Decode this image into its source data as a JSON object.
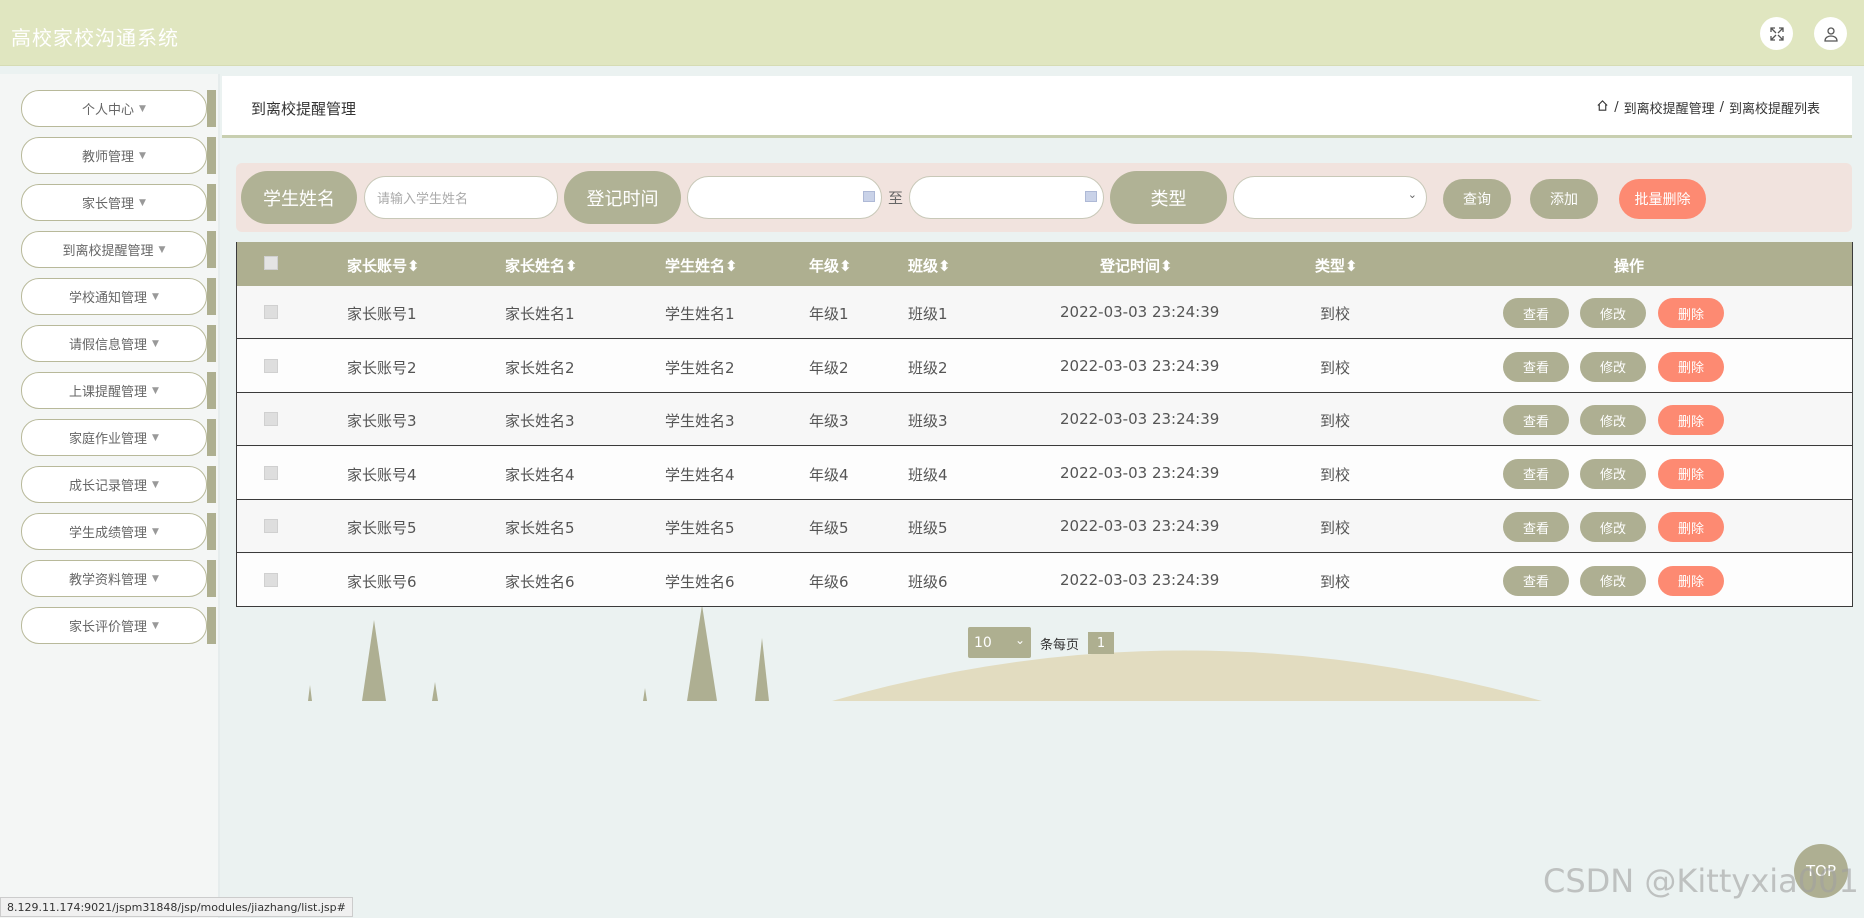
{
  "header": {
    "app_title": "高校家校沟通系统",
    "icons": [
      "fullscreen-icon",
      "user-icon"
    ]
  },
  "sidebar": {
    "items": [
      {
        "label": "个人中心"
      },
      {
        "label": "教师管理"
      },
      {
        "label": "家长管理"
      },
      {
        "label": "到离校提醒管理"
      },
      {
        "label": "学校通知管理"
      },
      {
        "label": "请假信息管理"
      },
      {
        "label": "上课提醒管理"
      },
      {
        "label": "家庭作业管理"
      },
      {
        "label": "成长记录管理"
      },
      {
        "label": "学生成绩管理"
      },
      {
        "label": "教学资料管理"
      },
      {
        "label": "家长评价管理"
      }
    ]
  },
  "page": {
    "title": "到离校提醒管理",
    "breadcrumb": [
      "到离校提醒管理",
      "到离校提醒列表"
    ]
  },
  "search": {
    "student_name_label": "学生姓名",
    "student_name_placeholder": "请输入学生姓名",
    "time_label": "登记时间",
    "to_label": "至",
    "type_label": "类型",
    "query_label": "查询",
    "add_label": "添加",
    "batch_delete_label": "批量删除"
  },
  "table": {
    "columns": [
      "家长账号",
      "家长姓名",
      "学生姓名",
      "年级",
      "班级",
      "登记时间",
      "类型",
      "操作"
    ],
    "rows": [
      {
        "account": "家长账号1",
        "parent": "家长姓名1",
        "student": "学生姓名1",
        "grade": "年级1",
        "class": "班级1",
        "time": "2022-03-03 23:24:39",
        "type": "到校"
      },
      {
        "account": "家长账号2",
        "parent": "家长姓名2",
        "student": "学生姓名2",
        "grade": "年级2",
        "class": "班级2",
        "time": "2022-03-03 23:24:39",
        "type": "到校"
      },
      {
        "account": "家长账号3",
        "parent": "家长姓名3",
        "student": "学生姓名3",
        "grade": "年级3",
        "class": "班级3",
        "time": "2022-03-03 23:24:39",
        "type": "到校"
      },
      {
        "account": "家长账号4",
        "parent": "家长姓名4",
        "student": "学生姓名4",
        "grade": "年级4",
        "class": "班级4",
        "time": "2022-03-03 23:24:39",
        "type": "到校"
      },
      {
        "account": "家长账号5",
        "parent": "家长姓名5",
        "student": "学生姓名5",
        "grade": "年级5",
        "class": "班级5",
        "time": "2022-03-03 23:24:39",
        "type": "到校"
      },
      {
        "account": "家长账号6",
        "parent": "家长姓名6",
        "student": "学生姓名6",
        "grade": "年级6",
        "class": "班级6",
        "time": "2022-03-03 23:24:39",
        "type": "到校"
      }
    ],
    "actions": {
      "view": "查看",
      "edit": "修改",
      "delete": "删除"
    }
  },
  "pagination": {
    "page_size": "10",
    "per_page_label": "条每页",
    "current_page": "1"
  },
  "status_url": "8.129.11.174:9021/jspm31848/jsp/modules/jiazhang/list.jsp#",
  "watermark": "CSDN @Kittyxia001",
  "top_button_label": "TOP",
  "colors": {
    "header_bg": "#e0e6c0",
    "accent": "#aeaf90",
    "danger": "#fd8a72",
    "search_panel_bg": "#f1e3de"
  }
}
